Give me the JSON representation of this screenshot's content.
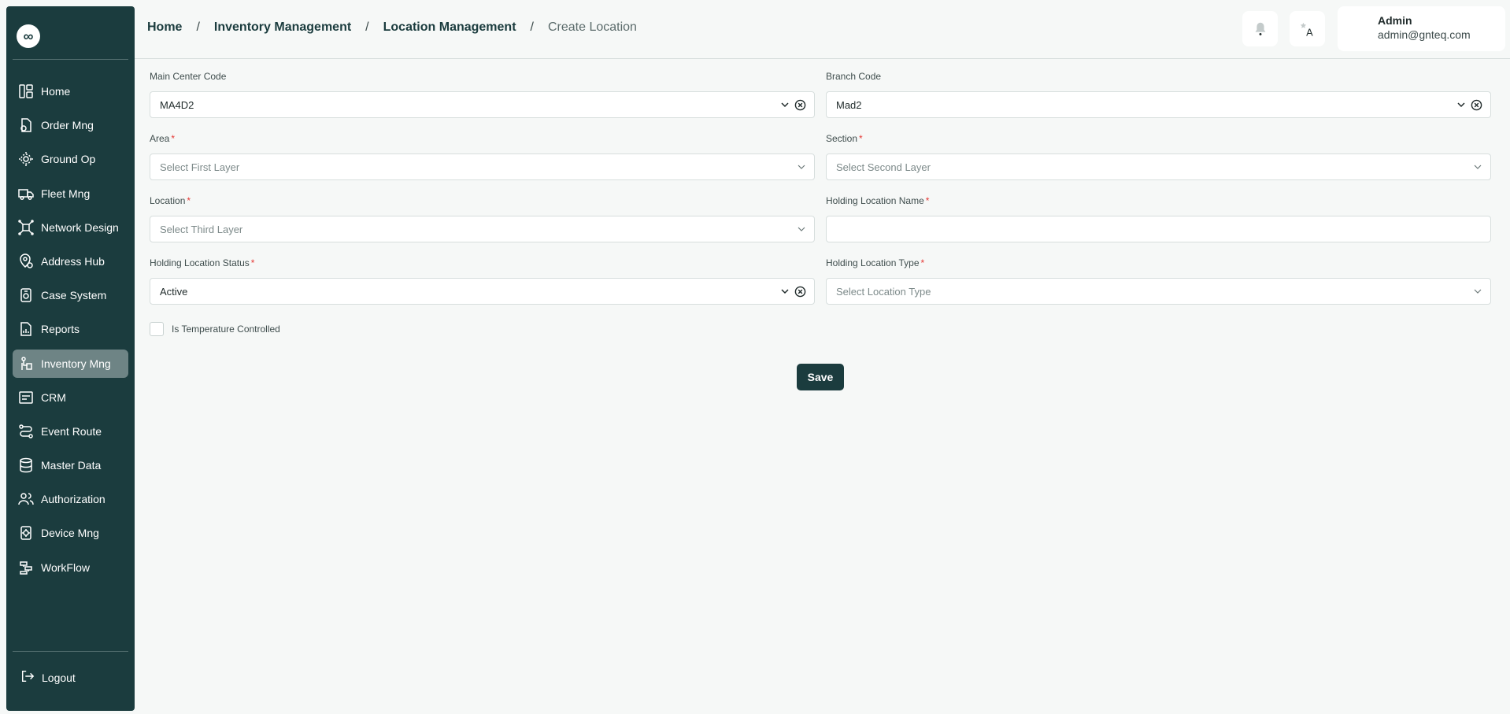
{
  "sidebar": {
    "logo_glyph": "∞",
    "items": [
      {
        "label": "Home",
        "icon": "dashboard-icon"
      },
      {
        "label": "Order Mng",
        "icon": "order-icon"
      },
      {
        "label": "Ground Op",
        "icon": "ground-op-icon"
      },
      {
        "label": "Fleet Mng",
        "icon": "truck-icon"
      },
      {
        "label": "Network Design",
        "icon": "network-icon"
      },
      {
        "label": "Address Hub",
        "icon": "location-pin-icon"
      },
      {
        "label": "Case System",
        "icon": "case-icon"
      },
      {
        "label": "Reports",
        "icon": "report-icon"
      },
      {
        "label": "Inventory Mng",
        "icon": "inventory-icon",
        "active": true
      },
      {
        "label": "CRM",
        "icon": "crm-icon"
      },
      {
        "label": "Event Route",
        "icon": "route-icon"
      },
      {
        "label": "Master Data",
        "icon": "database-icon"
      },
      {
        "label": "Authorization",
        "icon": "users-icon"
      },
      {
        "label": "Device Mng",
        "icon": "device-icon"
      },
      {
        "label": "WorkFlow",
        "icon": "workflow-icon"
      }
    ],
    "logout_label": "Logout"
  },
  "header": {
    "breadcrumb": [
      "Home",
      "Inventory Management",
      "Location Management",
      "Create Location"
    ],
    "breadcrumb_separator": "/",
    "user": {
      "name": "Admin",
      "email": "admin@gnteq.com"
    }
  },
  "form": {
    "main_center_code": {
      "label": "Main Center Code",
      "value": "MA4D2"
    },
    "branch_code": {
      "label": "Branch Code",
      "value": "Mad2"
    },
    "area": {
      "label": "Area",
      "placeholder": "Select First Layer",
      "required": "*"
    },
    "section": {
      "label": "Section",
      "placeholder": "Select Second Layer",
      "required": "*"
    },
    "location": {
      "label": "Location",
      "placeholder": "Select Third Layer",
      "required": "*"
    },
    "holding_location_name": {
      "label": "Holding Location Name",
      "value": "",
      "required": "*"
    },
    "holding_location_status": {
      "label": "Holding Location Status",
      "value": "Active",
      "required": "*"
    },
    "holding_location_type": {
      "label": "Holding Location Type",
      "placeholder": "Select Location Type",
      "required": "*"
    },
    "temperature_controlled": {
      "label": "Is Temperature Controlled",
      "checked": false
    },
    "save_label": "Save"
  },
  "colors": {
    "sidebar_bg": "#1b3c3e",
    "active_item": "#6e8485",
    "accent": "#1b3c3e",
    "required": "#e53935",
    "page_bg": "#f6f8f7"
  }
}
